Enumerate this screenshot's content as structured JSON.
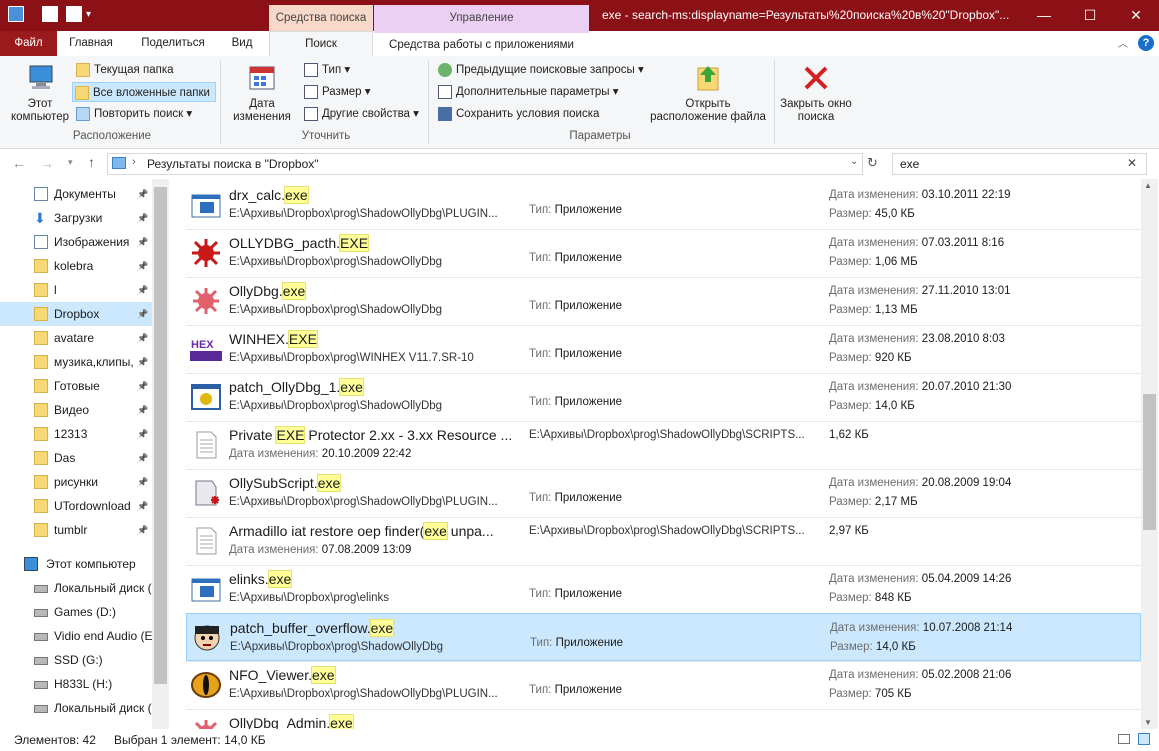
{
  "window": {
    "context_tab_search_tools": "Средства поиска",
    "context_tab_manage": "Управление",
    "title": "exe - search-ms:displayname=Результаты%20поиска%20в%20\"Dropbox\"..."
  },
  "tabs": {
    "file": "Файл",
    "home": "Главная",
    "share": "Поделиться",
    "view": "Вид",
    "search": "Поиск",
    "app_tools": "Средства работы с приложениями"
  },
  "ribbon": {
    "location": {
      "this_pc": "Этот компьютер",
      "current_folder": "Текущая папка",
      "all_subfolders": "Все вложенные папки",
      "search_again": "Повторить поиск",
      "label": "Расположение"
    },
    "refine": {
      "date_modified": "Дата изменения",
      "kind": "Тип",
      "size": "Размер",
      "other_properties": "Другие свойства",
      "label": "Уточнить"
    },
    "options": {
      "recent_searches": "Предыдущие поисковые запросы",
      "advanced_options": "Дополнительные параметры",
      "save_search": "Сохранить условия поиска",
      "open_file_location": "Открыть расположение файла",
      "close_search": "Закрыть окно поиска",
      "label": "Параметры"
    }
  },
  "address": {
    "path": "Результаты поиска в \"Dropbox\"",
    "search_value": "exe"
  },
  "nav": {
    "quick_access": [
      {
        "label": "Документы",
        "icon": "documents-icon"
      },
      {
        "label": "Загрузки",
        "icon": "downloads-icon"
      },
      {
        "label": "Изображения",
        "icon": "pictures-icon"
      },
      {
        "label": "kolebra",
        "icon": "folder-icon"
      },
      {
        "label": "l",
        "icon": "folder-icon"
      },
      {
        "label": "Dropbox",
        "icon": "folder-icon"
      },
      {
        "label": "avatare",
        "icon": "folder-icon"
      },
      {
        "label": "музика,клипы,",
        "icon": "folder-icon"
      },
      {
        "label": "Готовые",
        "icon": "folder-icon"
      },
      {
        "label": "Видео",
        "icon": "folder-icon"
      },
      {
        "label": "12313",
        "icon": "folder-icon"
      },
      {
        "label": "Das",
        "icon": "folder-icon"
      },
      {
        "label": "рисунки",
        "icon": "folder-icon"
      },
      {
        "label": "UTordownload",
        "icon": "folder-icon"
      },
      {
        "label": "tumblr",
        "icon": "folder-icon"
      }
    ],
    "this_pc": "Этот компьютер",
    "drives": [
      "Локальный диск (",
      "Games (D:)",
      "Vidio end Audio (E",
      "SSD  (G:)",
      "H833L (H:)",
      "Локальный диск ("
    ]
  },
  "labels": {
    "type": "Тип:",
    "date_modified": "Дата изменения:",
    "size": "Размер:"
  },
  "files": [
    {
      "name_pre": "drx_calc.",
      "name_hl": "exe",
      "name_post": "",
      "path": "E:\\Архивы\\Dropbox\\prog\\ShadowOllyDbg\\PLUGIN...",
      "type": "Приложение",
      "date": "03.10.2011 22:19",
      "size": "45,0 КБ",
      "icon": "window-app-icon"
    },
    {
      "name_pre": "OLLYDBG_pacth.",
      "name_hl": "EXE",
      "name_post": "",
      "path": "E:\\Архивы\\Dropbox\\prog\\ShadowOllyDbg",
      "type": "Приложение",
      "date": "07.03.2011 8:16",
      "size": "1,06 МБ",
      "icon": "red-bug-icon"
    },
    {
      "name_pre": "OllyDbg.",
      "name_hl": "exe",
      "name_post": "",
      "path": "E:\\Архивы\\Dropbox\\prog\\ShadowOllyDbg",
      "type": "Приложение",
      "date": "27.11.2010 13:01",
      "size": "1,13 МБ",
      "icon": "pink-bug-icon"
    },
    {
      "name_pre": "WINHEX.",
      "name_hl": "EXE",
      "name_post": "",
      "path": "E:\\Архивы\\Dropbox\\prog\\WINHEX V11.7.SR-10",
      "type": "Приложение",
      "date": "23.08.2010 8:03",
      "size": "920 КБ",
      "icon": "winhex-icon"
    },
    {
      "name_pre": "patch_OllyDbg_1.",
      "name_hl": "exe",
      "name_post": "",
      "path": "E:\\Архивы\\Dropbox\\prog\\ShadowOllyDbg",
      "type": "Приложение",
      "date": "20.07.2010 21:30",
      "size": "14,0 КБ",
      "icon": "patch-icon"
    },
    {
      "doc": true,
      "name_pre": "Private ",
      "name_hl": "EXE",
      "name_post": " Protector 2.xx - 3.xx Resource ...",
      "path": "E:\\Архивы\\Dropbox\\prog\\ShadowOllyDbg\\SCRIPTS...",
      "date": "20.10.2009 22:42",
      "size": "1,62 КБ",
      "icon": "text-document-icon"
    },
    {
      "name_pre": "OllySubScript.",
      "name_hl": "exe",
      "name_post": "",
      "path": "E:\\Архивы\\Dropbox\\prog\\ShadowOllyDbg\\PLUGIN...",
      "type": "Приложение",
      "date": "20.08.2009 19:04",
      "size": "2,17 МБ",
      "icon": "script-icon"
    },
    {
      "doc": true,
      "name_pre": "Armadillo iat restore oep finder(",
      "name_hl": "exe",
      "name_post": " unpa...",
      "path": "E:\\Архивы\\Dropbox\\prog\\ShadowOllyDbg\\SCRIPTS...",
      "date": "07.08.2009 13:09",
      "size": "2,97 КБ",
      "icon": "text-document-icon"
    },
    {
      "name_pre": "elinks.",
      "name_hl": "exe",
      "name_post": "",
      "path": "E:\\Архивы\\Dropbox\\prog\\elinks",
      "type": "Приложение",
      "date": "05.04.2009 14:26",
      "size": "848 КБ",
      "icon": "window-app-icon"
    },
    {
      "name_pre": "patch_buffer_overflow.",
      "name_hl": "exe",
      "name_post": "",
      "path": "E:\\Архивы\\Dropbox\\prog\\ShadowOllyDbg",
      "type": "Приложение",
      "date": "10.07.2008 21:14",
      "size": "14,0 КБ",
      "icon": "cartoon-face-icon",
      "selected": true
    },
    {
      "name_pre": "NFO_Viewer.",
      "name_hl": "exe",
      "name_post": "",
      "path": "E:\\Архивы\\Dropbox\\prog\\ShadowOllyDbg\\PLUGIN...",
      "type": "Приложение",
      "date": "05.02.2008 21:06",
      "size": "705 КБ",
      "icon": "cat-eye-icon"
    },
    {
      "name_pre": "OllyDbg_Admin.",
      "name_hl": "exe",
      "name_post": "",
      "path": "",
      "type": "",
      "date": "18.11.2007 4:24",
      "size": "",
      "icon": "pink-bug-icon",
      "partial": true
    }
  ],
  "status": {
    "count": "Элементов: 42",
    "selected": "Выбран 1 элемент: 14,0 КБ"
  }
}
